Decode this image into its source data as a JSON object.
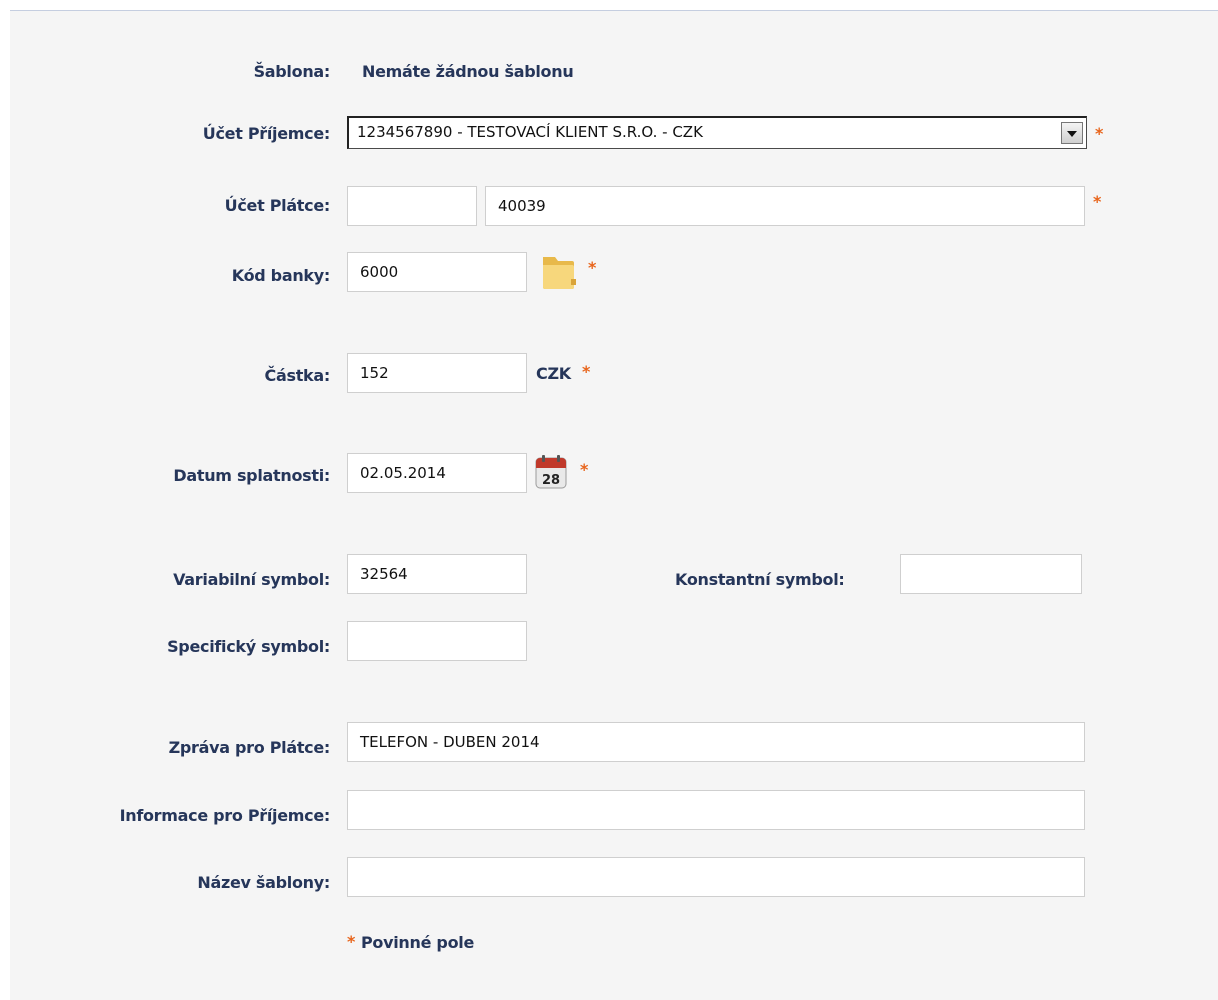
{
  "form": {
    "template_label": "Šablona:",
    "template_value": "Nemáte žádnou šablonu",
    "recipient_account_label": "Účet Příjemce:",
    "recipient_account_selected": "1234567890 - TESTOVACÍ KLIENT S.R.O. - CZK",
    "payer_account_label": "Účet Plátce:",
    "payer_account_prefix": "",
    "payer_account_number": "40039",
    "bank_code_label": "Kód banky:",
    "bank_code_value": "6000",
    "amount_label": "Částka:",
    "amount_value": "152",
    "currency": "CZK",
    "due_date_label": "Datum splatnosti:",
    "due_date_value": "02.05.2014",
    "calendar_day": "28",
    "variable_symbol_label": "Variabilní symbol:",
    "variable_symbol_value": "32564",
    "constant_symbol_label": "Konstantní symbol:",
    "constant_symbol_value": "",
    "specific_symbol_label": "Specifický symbol:",
    "specific_symbol_value": "",
    "message_payer_label": "Zpráva pro Plátce:",
    "message_payer_value": "TELEFON - DUBEN 2014",
    "info_recipient_label": "Informace pro Příjemce:",
    "info_recipient_value": "",
    "template_name_label": "Název šablony:",
    "template_name_value": "",
    "required_marker": "*",
    "required_note": "Povinné pole"
  },
  "icons": {
    "bank_lookup": "folder-icon",
    "date_picker": "calendar-icon",
    "dropdown": "chevron-down-icon"
  },
  "colors": {
    "label_text": "#26365a",
    "required": "#e8641b",
    "panel_bg": "#f5f5f5"
  }
}
